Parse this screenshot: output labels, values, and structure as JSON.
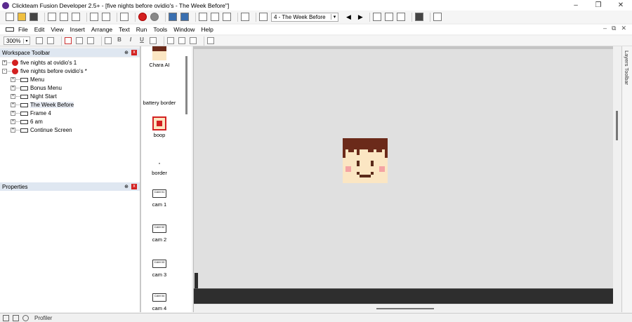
{
  "window": {
    "title": "Clickteam Fusion Developer 2.5+ - [five nights before ovidio's - The Week Before\"]",
    "minimize": "–",
    "maximize": "❐",
    "close": "✕"
  },
  "toolbar": {
    "frame_select": "4 - The Week Before",
    "dropdown_arrow": "▾",
    "prev": "◀",
    "next": "▶"
  },
  "menu": {
    "items": [
      "File",
      "Edit",
      "View",
      "Insert",
      "Arrange",
      "Text",
      "Run",
      "Tools",
      "Window",
      "Help"
    ],
    "mdi_min": "–",
    "mdi_restore": "⧉",
    "mdi_close": "✕"
  },
  "toolbar2": {
    "zoom": "300%",
    "bold": "B",
    "italic": "I",
    "underline": "U"
  },
  "workspace": {
    "title": "Workspace Toolbar",
    "pin": "⊕",
    "close": "x",
    "tree": [
      {
        "label": "five nights at ovidio's 1",
        "kind": "app",
        "level": 0,
        "expander": "+"
      },
      {
        "label": "five nights before ovidio's *",
        "kind": "app",
        "level": 0,
        "expander": "-"
      },
      {
        "label": "Menu",
        "kind": "frame",
        "level": 1,
        "expander": "+"
      },
      {
        "label": "Bonus Menu",
        "kind": "frame",
        "level": 1,
        "expander": "+"
      },
      {
        "label": "Night Start",
        "kind": "frame",
        "level": 1,
        "expander": "+"
      },
      {
        "label": "The Week Before",
        "kind": "frame",
        "level": 1,
        "expander": "+",
        "selected": true
      },
      {
        "label": "Frame 4",
        "kind": "frame",
        "level": 1,
        "expander": "+"
      },
      {
        "label": "6 am",
        "kind": "frame",
        "level": 1,
        "expander": "+"
      },
      {
        "label": "Continue Screen",
        "kind": "frame",
        "level": 1,
        "expander": "+"
      }
    ]
  },
  "properties": {
    "title": "Properties",
    "pin": "⊕",
    "close": "x"
  },
  "library": {
    "items": [
      {
        "label": "Chara AI",
        "thumb": "face"
      },
      {
        "label": "battery border",
        "thumb": "blank"
      },
      {
        "label": "boop",
        "thumb": "red-face"
      },
      {
        "label": "border",
        "thumb": "dot"
      },
      {
        "label": "cam 1",
        "thumb": "cam",
        "cam_text": "CAM 01"
      },
      {
        "label": "cam 2",
        "thumb": "cam",
        "cam_text": "CAM 02"
      },
      {
        "label": "cam 3",
        "thumb": "cam",
        "cam_text": "CAM 03"
      },
      {
        "label": "cam 4",
        "thumb": "cam",
        "cam_text": "CAM 04"
      }
    ]
  },
  "layers": {
    "label": "Layers Toolbar"
  },
  "statusbar": {
    "profiler": "Profiler"
  },
  "colors": {
    "hair": "#6b2a1a",
    "skin": "#fbe6c3",
    "cheek": "#f4a3a3",
    "eye": "#5a2a1a",
    "accent_red": "#d32020"
  }
}
